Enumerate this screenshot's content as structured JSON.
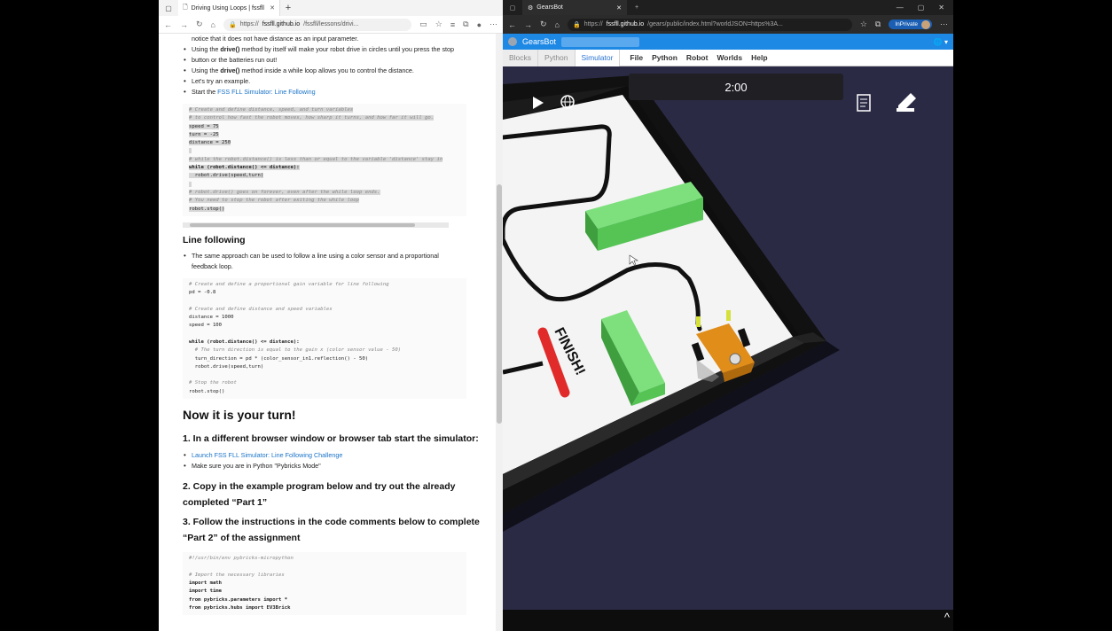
{
  "left_browser": {
    "tab_title": "Driving Using Loops | fssfll",
    "url_prefix": "https://",
    "url_host": "fssfll.github.io",
    "url_path": "/fssfll/lessons/drivi...",
    "intro_line": "notice that it does not have distance as an input parameter.",
    "bullets": [
      {
        "pre": "Using the ",
        "bold": "drive()",
        "post": " method by itself will make your robot drive in circles until you press the stop"
      },
      {
        "pre": "button or the batteries run out!",
        "bold": "",
        "post": ""
      },
      {
        "pre": "Using the ",
        "bold": "drive()",
        "post": " method inside a while loop allows you to control the distance."
      },
      {
        "pre": "Let's try an example.",
        "bold": "",
        "post": ""
      }
    ],
    "start_text": "Start the ",
    "start_link": "FSS FLL Simulator: Line Following",
    "code1": [
      "# Create and define distance, speed, and turn variables",
      "# to control how fast the robot moves, how sharp it turns, and how far it will go.",
      "speed = 75",
      "turn = -25",
      "distance = 250",
      "",
      "# while the robot.distance() is less than or equal to the variable 'distance' stay in",
      "while (robot.distance() <= distance):",
      "  robot.drive(speed,turn)",
      "",
      "# robot.drive() goes on forever, even after the while loop ends.",
      "# You need to stop the robot after exiting the while loop",
      "robot.stop()"
    ],
    "heading_line_following": "Line following",
    "lf_text_1": "The same approach can be used to follow a line using a color sensor and a proportional",
    "lf_text_2": "feedback loop.",
    "code2": [
      "# Create and define a proportional gain variable for line following",
      "pd = -0.8",
      "",
      "# Create and define distance and speed variables",
      "distance = 1000",
      "speed = 100",
      "",
      "while (robot.distance() <= distance):",
      "  # The turn direction is equal to the gain x (color sensor value - 50)",
      "  turn_direction = pd * (color_sensor_in1.reflection() - 50)",
      "  robot.drive(speed,turn)",
      "",
      "# Stop the robot",
      "robot.stop()"
    ],
    "heading_turn": "Now it is your turn!",
    "step1": "1. In a different browser window or browser tab start the simulator:",
    "step1_link": "Launch FSS FLL Simulator: Line Following Challenge",
    "step1_note": "Make sure you are in Python \"Pybricks Mode\"",
    "step2": "2. Copy in the example program below and try out the already completed “Part 1”",
    "step3": "3. Follow the instructions in the code comments below to complete “Part 2” of the assignment",
    "code3": [
      "#!/usr/bin/env pybricks-micropython",
      "",
      "# Import the necessary libraries",
      "import math",
      "import time",
      "from pybricks.parameters import *",
      "from pybricks.hubs import EV3Brick"
    ]
  },
  "right_browser": {
    "tab_title": "GearsBot",
    "url_prefix": "https://",
    "url_host": "fssfll.github.io",
    "url_path": "/gears/public/index.html?worldJSON=https%3A...",
    "inprivate_label": "InPrivate",
    "app_name": "GearsBot",
    "mode_tabs": [
      "Blocks",
      "Python",
      "Simulator"
    ],
    "menu_items": [
      "File",
      "Python",
      "Robot",
      "Worlds",
      "Help"
    ],
    "timer": "2:00",
    "finish_label": "FINISH!",
    "scroll_caret": "^"
  }
}
